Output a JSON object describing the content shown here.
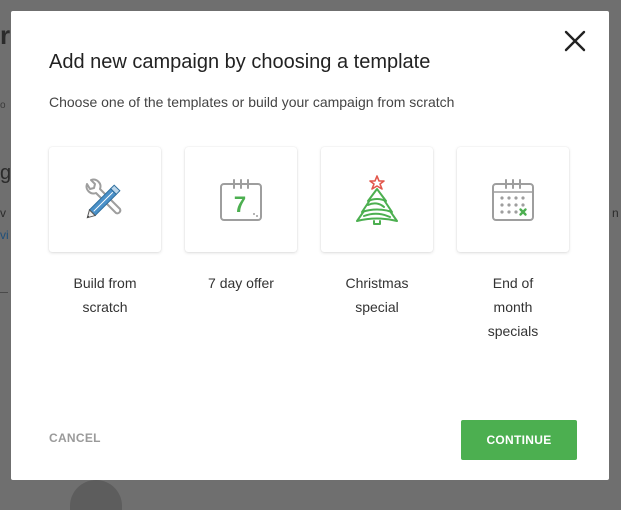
{
  "background": {
    "fragments": [
      "r",
      "o",
      "g",
      "v",
      "vi",
      "n"
    ]
  },
  "modal": {
    "title": "Add new campaign by choosing a template",
    "subtitle": "Choose one of the templates or build your campaign from scratch",
    "close_icon": "close-icon"
  },
  "templates": [
    {
      "label_lines": [
        "Build from",
        "scratch"
      ],
      "icon": "wrench-pencil-icon"
    },
    {
      "label_lines": [
        "7 day offer"
      ],
      "icon": "calendar-seven-icon",
      "icon_text": "7"
    },
    {
      "label_lines": [
        "Christmas",
        "special"
      ],
      "icon": "christmas-tree-icon"
    },
    {
      "label_lines": [
        "End of",
        "month",
        "specials"
      ],
      "icon": "calendar-grid-icon"
    }
  ],
  "footer": {
    "cancel_label": "CANCEL",
    "continue_label": "CONTINUE"
  },
  "colors": {
    "overlay": "#6f6f6f",
    "accent_green": "#4caf50",
    "icon_blue": "#4a90c8",
    "icon_grey": "#9e9e9e",
    "star_red": "#e2574c"
  }
}
